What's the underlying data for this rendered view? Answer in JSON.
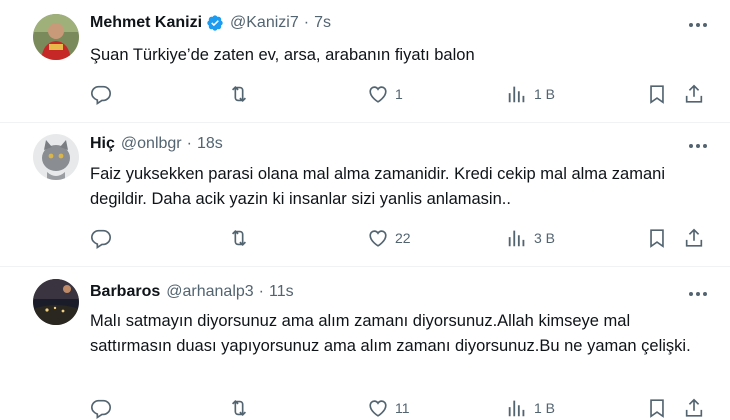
{
  "tweets": [
    {
      "name": "Mehmet Kanizi",
      "handle": "@Kanizi7",
      "time": "7s",
      "verified": true,
      "text": "Şuan Türkiye’de zaten ev, arsa, arabanın fiyatı balon",
      "likes": "1",
      "views": "1 B"
    },
    {
      "name": "Hiç",
      "handle": "@onlbgr",
      "time": "18s",
      "verified": false,
      "text": "Faiz yuksekken parasi olana mal alma zamanidir. Kredi cekip mal alma zamani degildir. Daha acik yazin ki insanlar sizi yanlis anlamasin..",
      "likes": "22",
      "views": "3 B"
    },
    {
      "name": "Barbaros",
      "handle": "@arhanalp3",
      "time": "11s",
      "verified": false,
      "text": "Malı satmayın diyorsunuz ama alım zamanı diyorsunuz.Allah kimseye mal sattırmasın duası yapıyorsunuz ama alım zamanı diyorsunuz.Bu ne yaman çelişki.",
      "likes": "11",
      "views": "1 B"
    }
  ],
  "separator": "·",
  "icons": [
    "reply-icon",
    "retweet-icon",
    "like-icon",
    "views-icon",
    "bookmark-icon",
    "share-icon",
    "more-icon",
    "verified-badge-icon"
  ],
  "colors": {
    "text": "#0f1419",
    "secondary": "#536471",
    "verified": "#1d9bf0",
    "border": "#eff3f4"
  }
}
